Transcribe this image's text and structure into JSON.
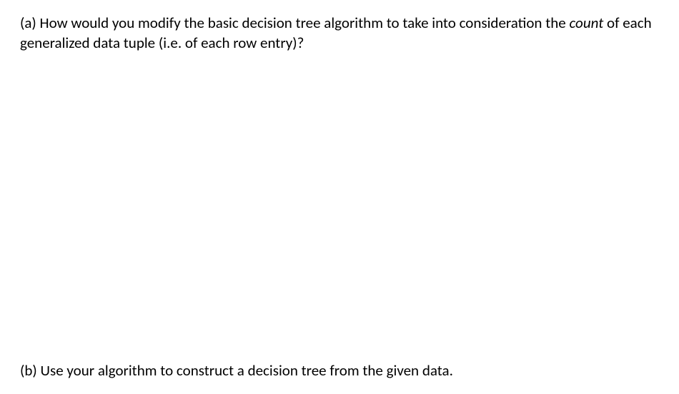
{
  "questions": {
    "a": {
      "label": "(a)",
      "text_before_italic": " How would you modify the basic decision tree algorithm to take into consideration the ",
      "italic_word": "count",
      "text_after_italic": " of each generalized data tuple (i.e. of each row entry)?"
    },
    "b": {
      "label": "(b)",
      "text": " Use your algorithm to construct a decision tree from the given data."
    }
  }
}
